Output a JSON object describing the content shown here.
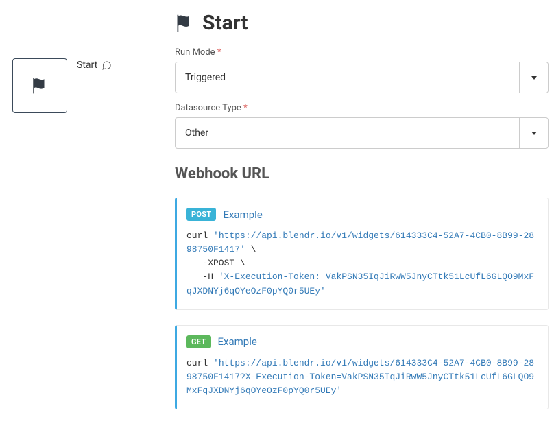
{
  "node": {
    "label": "Start"
  },
  "title": "Start",
  "form": {
    "runMode": {
      "label": "Run Mode",
      "required": "*",
      "value": "Triggered"
    },
    "datasourceType": {
      "label": "Datasource Type",
      "required": "*",
      "value": "Other"
    }
  },
  "webhook": {
    "heading": "Webhook URL",
    "post": {
      "badge": "POST",
      "title": "Example",
      "cmd": "curl ",
      "url": "'https://api.blendr.io/v1/widgets/614333C4-52A7-4CB0-8B99-2898750F1417'",
      "line2": " \\",
      "line3": "   -XPOST \\",
      "line4_prefix": "   -H ",
      "header": "'X-Execution-Token: VakPSN35IqJiRwW5JnyCTtk51LcUfL6GLQO9MxFqJXDNYj6qOYeOzF0pYQ0r5UEy'"
    },
    "get": {
      "badge": "GET",
      "title": "Example",
      "cmd": "curl ",
      "url": "'https://api.blendr.io/v1/widgets/614333C4-52A7-4CB0-8B99-2898750F1417?X-Execution-Token=VakPSN35IqJiRwW5JnyCTtk51LcUfL6GLQO9MxFqJXDNYj6qOYeOzF0pYQ0r5UEy'"
    }
  }
}
